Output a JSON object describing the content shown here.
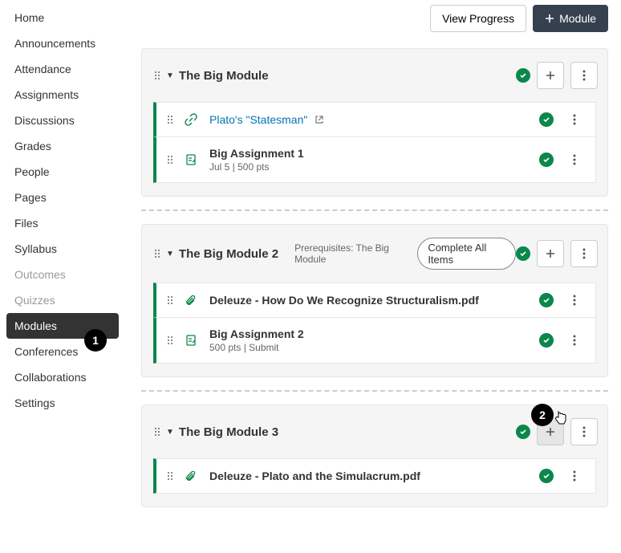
{
  "sidebar": {
    "items": [
      {
        "label": "Home",
        "state": "normal"
      },
      {
        "label": "Announcements",
        "state": "normal"
      },
      {
        "label": "Attendance",
        "state": "normal"
      },
      {
        "label": "Assignments",
        "state": "normal"
      },
      {
        "label": "Discussions",
        "state": "normal"
      },
      {
        "label": "Grades",
        "state": "normal"
      },
      {
        "label": "People",
        "state": "normal"
      },
      {
        "label": "Pages",
        "state": "normal"
      },
      {
        "label": "Files",
        "state": "normal"
      },
      {
        "label": "Syllabus",
        "state": "normal"
      },
      {
        "label": "Outcomes",
        "state": "muted"
      },
      {
        "label": "Quizzes",
        "state": "muted"
      },
      {
        "label": "Modules",
        "state": "active"
      },
      {
        "label": "Conferences",
        "state": "normal"
      },
      {
        "label": "Collaborations",
        "state": "normal"
      },
      {
        "label": "Settings",
        "state": "normal"
      }
    ]
  },
  "topbar": {
    "view_progress": "View Progress",
    "add_module": "Module"
  },
  "modules": [
    {
      "title": "The Big Module",
      "prereq": "",
      "pill": "",
      "items": [
        {
          "kind": "link",
          "title": "Plato's \"Statesman\"",
          "meta": "",
          "bold": false,
          "external": true
        },
        {
          "kind": "assignment",
          "title": "Big Assignment 1",
          "meta": "Jul 5  |  500 pts",
          "bold": true,
          "external": false
        }
      ]
    },
    {
      "title": "The Big Module 2",
      "prereq": "Prerequisites: The Big Module",
      "pill": "Complete All Items",
      "items": [
        {
          "kind": "file",
          "title": "Deleuze - How Do We Recognize Structuralism.pdf",
          "meta": "",
          "bold": true,
          "external": false
        },
        {
          "kind": "assignment",
          "title": "Big Assignment 2",
          "meta": "500 pts  |  Submit",
          "bold": true,
          "external": false
        }
      ]
    },
    {
      "title": "The Big Module 3",
      "prereq": "",
      "pill": "",
      "add_hover": true,
      "items": [
        {
          "kind": "file",
          "title": "Deleuze - Plato and the Simulacrum.pdf",
          "meta": "",
          "bold": true,
          "external": false
        }
      ]
    }
  ],
  "callouts": {
    "one": "1",
    "two": "2"
  }
}
